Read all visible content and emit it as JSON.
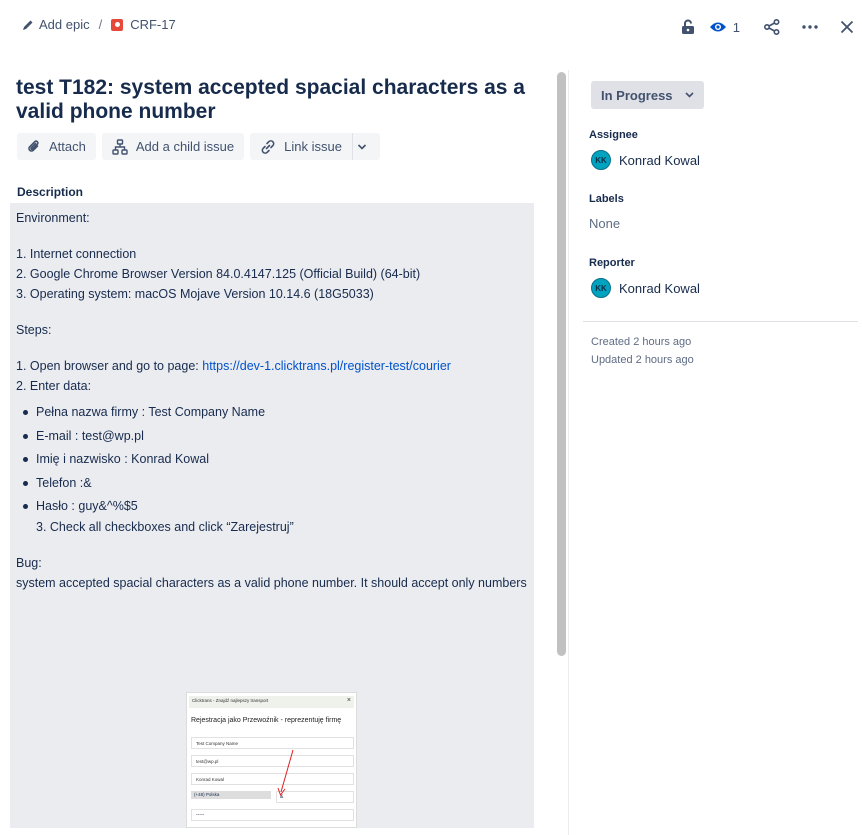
{
  "breadcrumb": {
    "epic_label": "Add epic",
    "separator": "/",
    "issue_key": "CRF-17"
  },
  "header": {
    "watchers_count": "1"
  },
  "issue": {
    "title": "test T182: system accepted spacial characters as a valid phone number"
  },
  "toolbar": {
    "attach": "Attach",
    "add_child": "Add a child issue",
    "link_issue": "Link issue"
  },
  "description": {
    "label": "Description",
    "env_heading": "Environment:",
    "env_items": [
      "1. Internet connection",
      "2. Google Chrome Browser Version 84.0.4147.125 (Official Build) (64-bit)",
      "3. Operating system: macOS Mojave Version 10.14.6 (18G5033)"
    ],
    "steps_heading": "Steps:",
    "step1_prefix": "1. Open browser and go to page: ",
    "step1_link": "https://dev-1.clicktrans.pl/register-test/courier",
    "step2": "2. Enter data:",
    "data_items": [
      "Pełna nazwa firmy : Test Company Name",
      "E-mail : test@wp.pl",
      "Imię i nazwisko : Konrad Kowal",
      "Telefon :&",
      "Hasło : guy&^%$5"
    ],
    "step3": "3. Check all checkboxes and click “Zarejestruj”",
    "bug_heading": "Bug:",
    "bug_text": "system accepted spacial characters as a valid phone number. It should accept only numbers",
    "attachment": {
      "top_bar": "Clicktrans - Znajdź najlepszy transport",
      "heading": "Rejestracja jako Przewoźnik - reprezentuję firmę",
      "company": "Test Company Name",
      "email": "test@wp.pl",
      "name": "Konrad Kowal",
      "country": "(+48) Polska",
      "phone": "&",
      "password": "-----"
    }
  },
  "sidebar": {
    "status": "In Progress",
    "assignee_label": "Assignee",
    "assignee_initials": "KK",
    "assignee_name": "Konrad Kowal",
    "labels_label": "Labels",
    "labels_value": "None",
    "reporter_label": "Reporter",
    "reporter_initials": "KK",
    "reporter_name": "Konrad Kowal",
    "created": "Created 2 hours ago",
    "updated": "Updated 2 hours ago"
  },
  "colors": {
    "link": "#0052cc",
    "avatar": "#00a3bf",
    "bug_icon": "#e5493a"
  }
}
